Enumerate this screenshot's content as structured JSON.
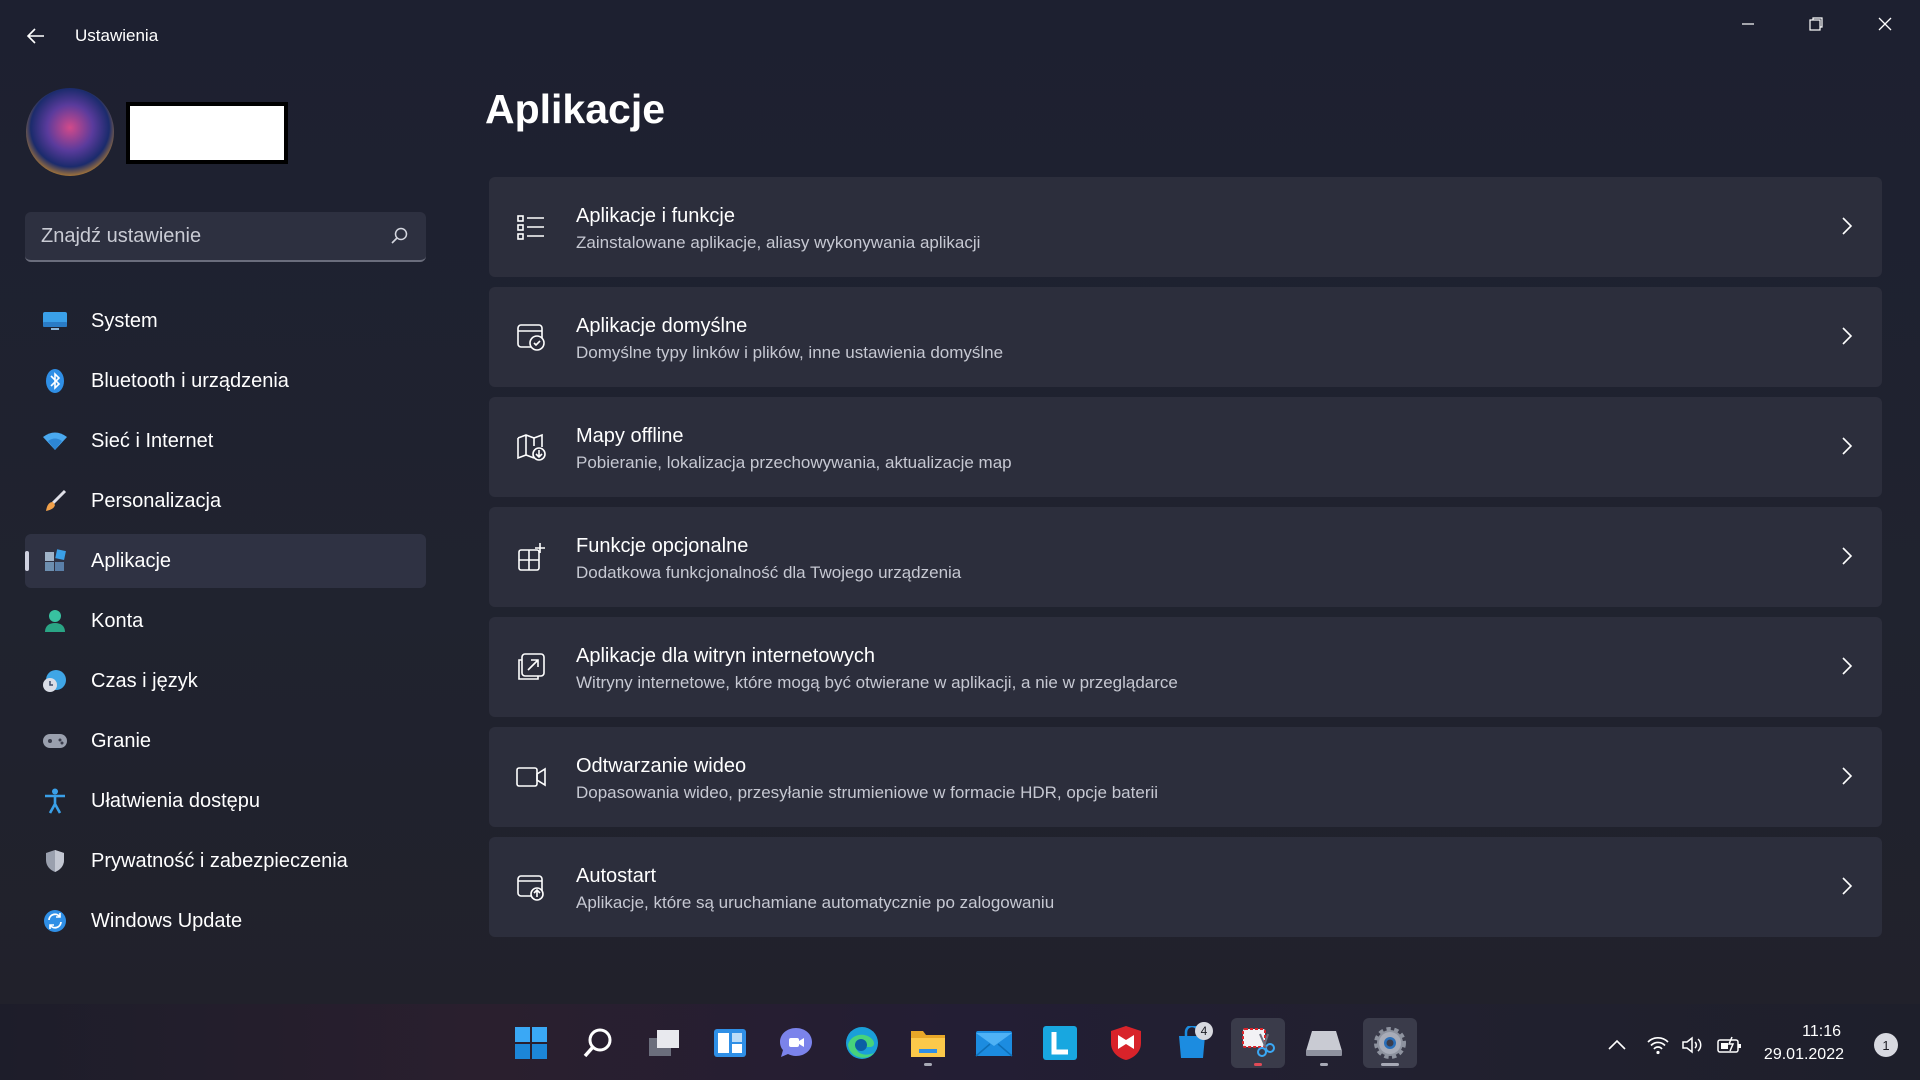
{
  "window": {
    "title": "Ustawienia",
    "controls": [
      "minimize",
      "restore",
      "close"
    ]
  },
  "search": {
    "placeholder": "Znajdź ustawienie"
  },
  "sidebar": {
    "items": [
      {
        "label": "System",
        "icon": "monitor-icon",
        "color": "#3aa0e8"
      },
      {
        "label": "Bluetooth i urządzenia",
        "icon": "bluetooth-icon",
        "color": "#2f8fe6"
      },
      {
        "label": "Sieć i Internet",
        "icon": "wifi-icon",
        "color": "#4aa9f0"
      },
      {
        "label": "Personalizacja",
        "icon": "brush-icon",
        "color": "#f0a04a"
      },
      {
        "label": "Aplikacje",
        "icon": "apps-icon",
        "color": "#6aa9e0",
        "active": true
      },
      {
        "label": "Konta",
        "icon": "account-icon",
        "color": "#38c2a0"
      },
      {
        "label": "Czas i język",
        "icon": "globe-clock-icon",
        "color": "#3fa6e6"
      },
      {
        "label": "Granie",
        "icon": "gamepad-icon",
        "color": "#9aa0ae"
      },
      {
        "label": "Ułatwienia dostępu",
        "icon": "accessibility-icon",
        "color": "#3aa0e8"
      },
      {
        "label": "Prywatność i zabezpieczenia",
        "icon": "shield-icon",
        "color": "#9aa0ae"
      },
      {
        "label": "Windows Update",
        "icon": "update-icon",
        "color": "#2f8fe6"
      }
    ]
  },
  "main": {
    "title": "Aplikacje",
    "cards": [
      {
        "title": "Aplikacje i funkcje",
        "subtitle": "Zainstalowane aplikacje, aliasy wykonywania aplikacji",
        "icon": "list-icon"
      },
      {
        "title": "Aplikacje domyślne",
        "subtitle": "Domyślne typy linków i plików, inne ustawienia domyślne",
        "icon": "default-apps-icon"
      },
      {
        "title": "Mapy offline",
        "subtitle": "Pobieranie, lokalizacja przechowywania, aktualizacje map",
        "icon": "map-download-icon"
      },
      {
        "title": "Funkcje opcjonalne",
        "subtitle": "Dodatkowa funkcjonalność dla Twojego urządzenia",
        "icon": "optional-features-icon"
      },
      {
        "title": "Aplikacje dla witryn internetowych",
        "subtitle": "Witryny internetowe, które mogą być otwierane w aplikacji, a nie w przeglądarce",
        "icon": "web-apps-icon"
      },
      {
        "title": "Odtwarzanie wideo",
        "subtitle": "Dopasowania wideo, przesyłanie strumieniowe w formacie HDR, opcje baterii",
        "icon": "video-icon"
      },
      {
        "title": "Autostart",
        "subtitle": "Aplikacje, które są uruchamiane automatycznie po zalogowaniu",
        "icon": "startup-icon"
      }
    ]
  },
  "taskbar": {
    "apps": [
      "start-icon",
      "search-icon",
      "task-view-icon",
      "widgets-icon",
      "chat-icon",
      "edge-icon",
      "file-explorer-icon",
      "mail-icon",
      "l-app-icon",
      "mcafee-icon",
      "store-icon",
      "snipping-tool-icon",
      "drive-icon",
      "settings-icon"
    ],
    "store_badge": "4",
    "clock": {
      "time": "11:16",
      "date": "29.01.2022"
    },
    "notifications": "1"
  }
}
